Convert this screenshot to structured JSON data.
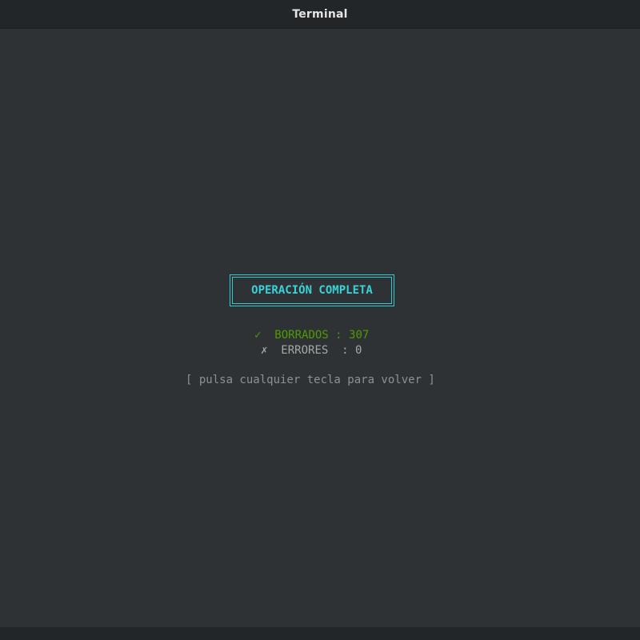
{
  "window": {
    "title": "Terminal"
  },
  "banner": {
    "text": "OPERACIÓN COMPLETA",
    "color": "#38d3d9"
  },
  "results": {
    "ok_icon": "✓",
    "ok_label": "BORRADOS",
    "ok_value": "307",
    "ok_color": "#4e9a06",
    "err_icon": "✗",
    "err_label": "ERRORES",
    "err_value": "0",
    "err_color": "#a6a8a8"
  },
  "hint": {
    "text": "[ pulsa cualquier tecla para volver ]"
  }
}
